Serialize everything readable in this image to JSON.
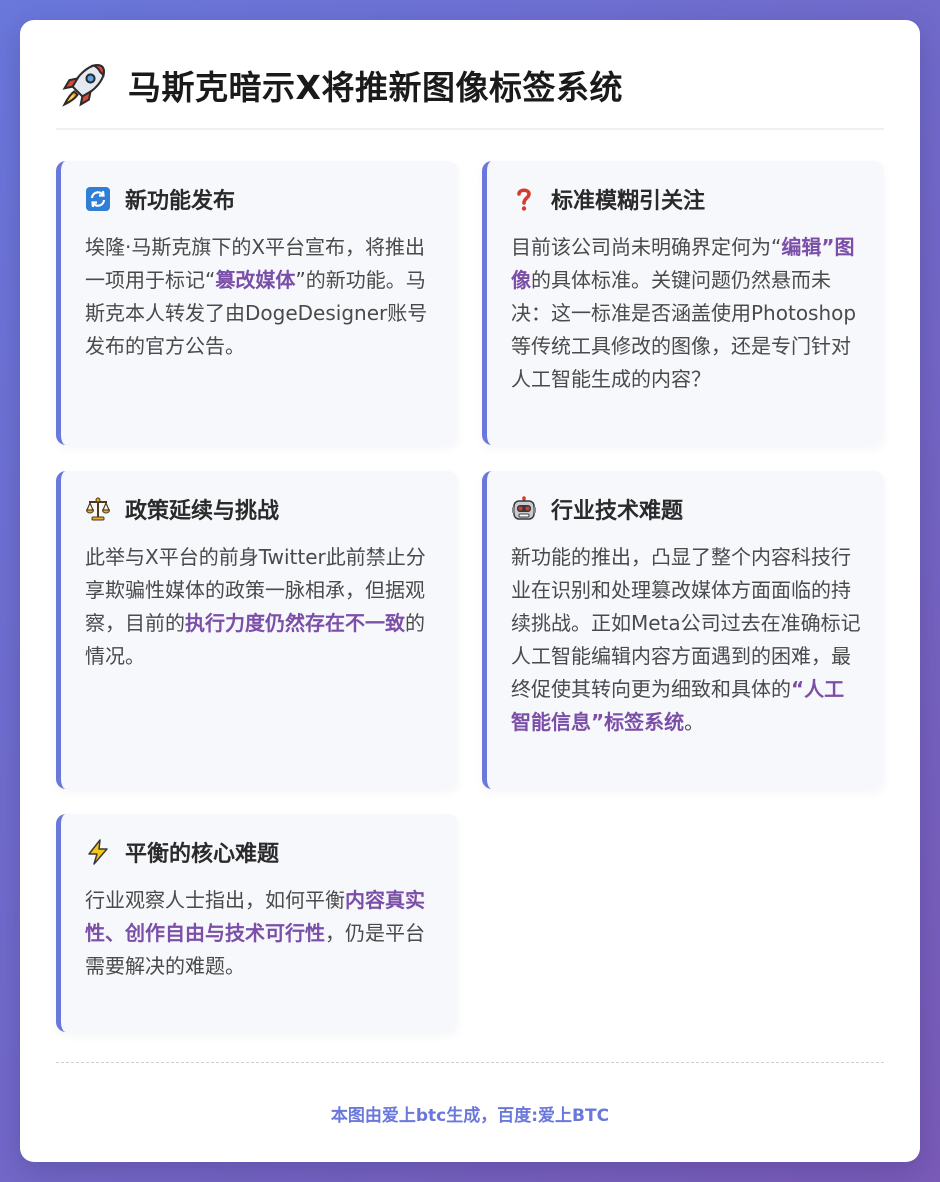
{
  "header": {
    "title": "马斯克暗示X将推新图像标签系统",
    "icon": "rocket-icon"
  },
  "sections": [
    {
      "icon": "refresh-icon",
      "title": "新功能发布",
      "parts": [
        "埃隆·马斯克旗下的X平台宣布，将推出一项用于标记“",
        "篡改媒体",
        "”的新功能。马斯克本人转发了由DogeDesigner账号发布的官方公告。"
      ]
    },
    {
      "icon": "question-icon",
      "title": "标准模糊引关注",
      "parts": [
        "目前该公司尚未明确界定何为“",
        "编辑”图像",
        "的具体标准。关键问题仍然悬而未决：这一标准是否涵盖使用Photoshop等传统工具修改的图像，还是专门针对人工智能生成的内容？"
      ]
    },
    {
      "icon": "scales-icon",
      "title": "政策延续与挑战",
      "parts": [
        "此举与X平台的前身Twitter此前禁止分享欺骗性媒体的政策一脉相承，但据观察，目前的",
        "执行力度仍然存在不一致",
        "的情况。"
      ]
    },
    {
      "icon": "robot-icon",
      "title": "行业技术难题",
      "parts": [
        "新功能的推出，凸显了整个内容科技行业在识别和处理篡改媒体方面面临的持续挑战。正如Meta公司过去在准确标记人工智能编辑内容方面遇到的困难，最终促使其转向更为细致和具体的",
        "“人工智能信息”标签系统",
        "。"
      ]
    },
    {
      "icon": "lightning-icon",
      "title": "平衡的核心难题",
      "parts": [
        "行业观察人士指出，如何平衡",
        "内容真实性、创作自由与技术可行性",
        "，仍是平台需要解决的难题。"
      ]
    }
  ],
  "footer": {
    "text": "本图由爱上btc生成，百度:爱上BTC"
  },
  "colors": {
    "accent": "#6a78dc",
    "highlight": "#7b4fa8"
  }
}
